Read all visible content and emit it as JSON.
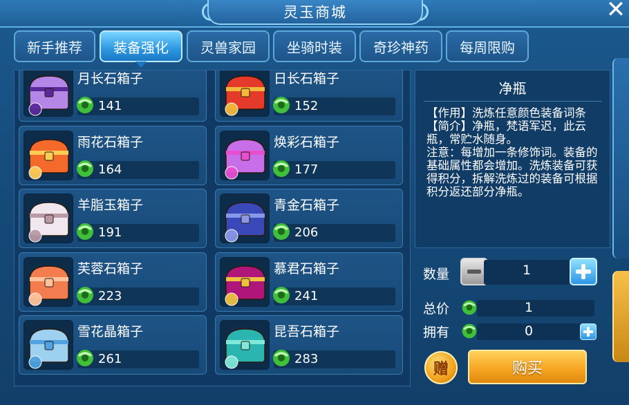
{
  "window": {
    "title": "灵玉商城",
    "close_icon": "close-icon"
  },
  "tabs": [
    {
      "label": "新手推荐",
      "active": false
    },
    {
      "label": "装备强化",
      "active": true
    },
    {
      "label": "灵兽家园",
      "active": false
    },
    {
      "label": "坐骑时装",
      "active": false
    },
    {
      "label": "奇珍神药",
      "active": false
    },
    {
      "label": "每周限购",
      "active": false
    }
  ],
  "items": [
    {
      "name": "月长石箱子",
      "price": "141",
      "icon": "purple-chest-icon",
      "colors": [
        "#b486e6",
        "#5b2a9a"
      ]
    },
    {
      "name": "日长石箱子",
      "price": "152",
      "icon": "red-gold-chest-icon",
      "colors": [
        "#e33a2a",
        "#f4b93b"
      ]
    },
    {
      "name": "雨花石箱子",
      "price": "164",
      "icon": "orange-chest-icon",
      "colors": [
        "#f36a2a",
        "#ffcc55"
      ]
    },
    {
      "name": "焕彩石箱子",
      "price": "177",
      "icon": "violet-chest-icon",
      "colors": [
        "#c86ee8",
        "#e64fd0"
      ]
    },
    {
      "name": "羊脂玉箱子",
      "price": "191",
      "icon": "white-chest-icon",
      "colors": [
        "#f1e8ef",
        "#b89aa6"
      ]
    },
    {
      "name": "青金石箱子",
      "price": "206",
      "icon": "blue-chest-icon",
      "colors": [
        "#3a49b8",
        "#8a98e8"
      ]
    },
    {
      "name": "芙蓉石箱子",
      "price": "223",
      "icon": "coral-chest-icon",
      "colors": [
        "#f47d50",
        "#ffc29a"
      ]
    },
    {
      "name": "慕君石箱子",
      "price": "241",
      "icon": "magenta-gold-chest-icon",
      "colors": [
        "#b0157a",
        "#f0c040"
      ]
    },
    {
      "name": "雪花晶箱子",
      "price": "261",
      "icon": "ice-chest-icon",
      "colors": [
        "#9ed0f0",
        "#4fa3e0"
      ]
    },
    {
      "name": "昆吾石箱子",
      "price": "283",
      "icon": "teal-chest-icon",
      "colors": [
        "#2ab5b0",
        "#7fe8d8"
      ]
    }
  ],
  "detail": {
    "title": "净瓶",
    "text": "【作用】洗炼任意颜色装备词条\n【简介】净瓶，梵语军迟，此云瓶，常贮水随身。\n注意：每增加一条修饰词。装备的基础属性都会增加。洗炼装备可获得积分，拆解洗炼过的装备可根据积分返还部分净瓶。"
  },
  "purchase": {
    "qty_label": "数量",
    "qty_value": "1",
    "total_label": "总价",
    "total_value": "1",
    "own_label": "拥有",
    "own_value": "0",
    "gift_label": "赠",
    "buy_label": "购买"
  },
  "currency_icon": "jade-coin-icon",
  "colors": {
    "accent": "#2d97e0",
    "buy": "#f6a623",
    "jade": "#3fbf3a"
  }
}
